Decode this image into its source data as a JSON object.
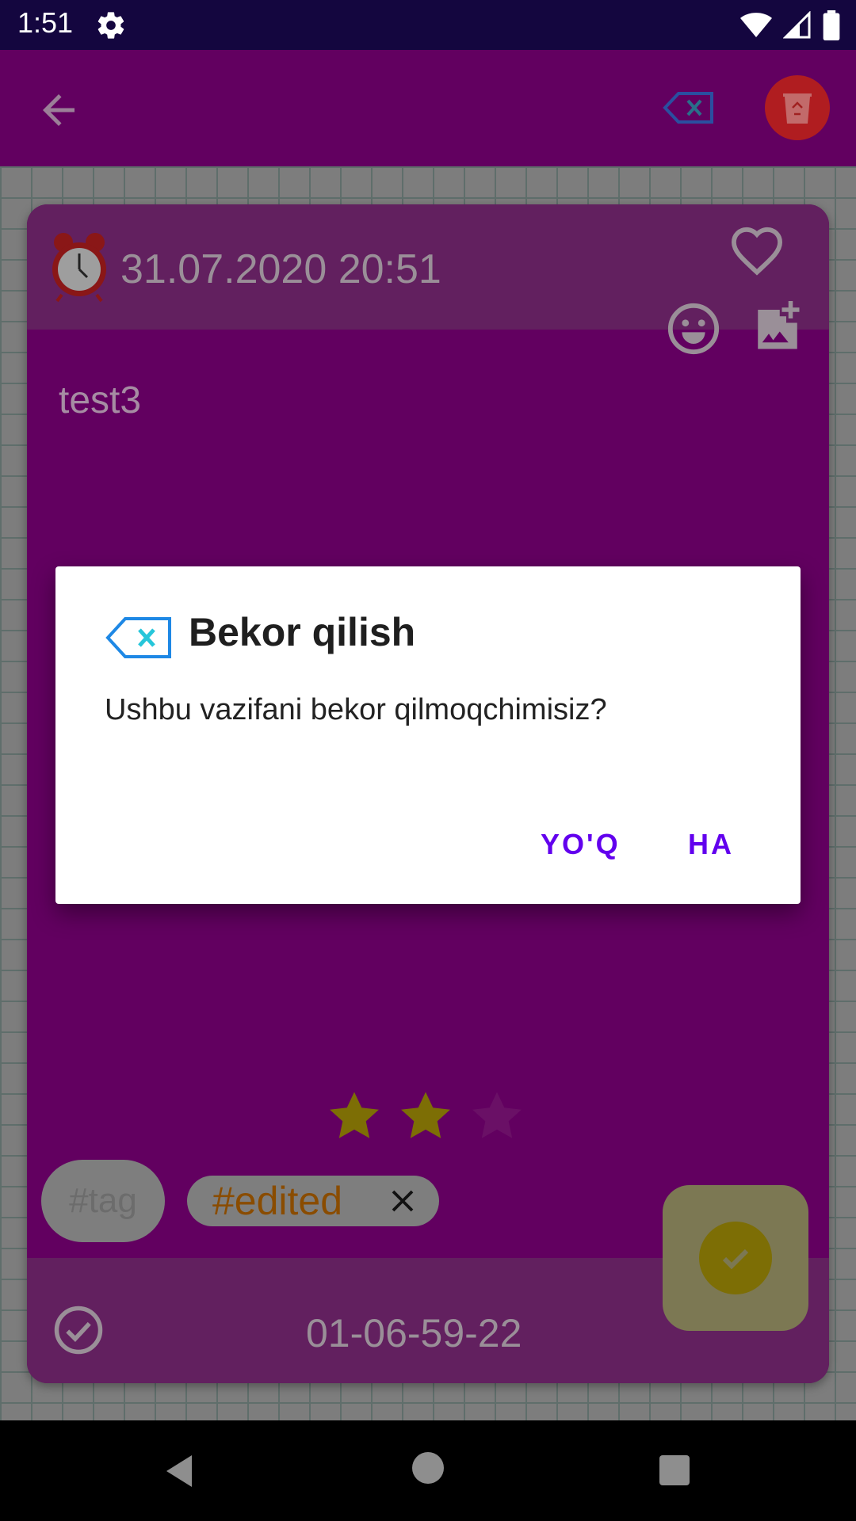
{
  "status_bar": {
    "time": "1:51"
  },
  "note": {
    "date": "31.07.2020 20:51",
    "text": "test3",
    "rating": 2,
    "rating_max": 3,
    "tags": [
      "#tag",
      "#edited"
    ],
    "footer_code": "01-06-59-22"
  },
  "dialog": {
    "title": "Bekor qilish",
    "message": "Ushbu vazifani bekor qilmoqchimisiz?",
    "negative_label": "YO'Q",
    "positive_label": "HA"
  },
  "colors": {
    "app_bar": "#620060",
    "dialog_button": "#6200ee",
    "cancel_icon": "#1e88e5",
    "cancel_icon_x": "#26c6da"
  }
}
